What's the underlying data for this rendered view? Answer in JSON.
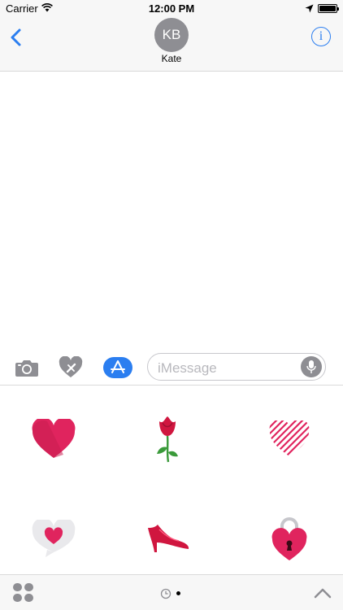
{
  "status_bar": {
    "carrier": "Carrier",
    "time": "12:00 PM",
    "battery_level": 1.0
  },
  "nav": {
    "contact_initials": "KB",
    "contact_name": "Kate",
    "info_glyph": "i"
  },
  "input_bar": {
    "placeholder": "iMessage",
    "camera_icon": "camera-icon",
    "sticker_app_icon": "heart-tools-icon",
    "app_store_icon": "app-store-icon",
    "mic_icon": "microphone-icon"
  },
  "stickers": [
    {
      "name": "red-heart",
      "label": "Red heart sticker"
    },
    {
      "name": "rose",
      "label": "Rose sticker"
    },
    {
      "name": "striped-heart",
      "label": "Striped heart sticker"
    },
    {
      "name": "heart-speech-bubble",
      "label": "Heart speech bubble sticker"
    },
    {
      "name": "red-high-heel",
      "label": "Red high heel sticker"
    },
    {
      "name": "heart-padlock",
      "label": "Heart padlock sticker"
    }
  ],
  "bottom_bar": {
    "apps_icon": "app-drawer-icon",
    "recents_icon": "clock-icon",
    "expand_icon": "chevron-up-icon"
  },
  "colors": {
    "accent": "#2b7ef0",
    "sticker_red": "#e0245e",
    "bar_background": "#f7f7f7"
  }
}
